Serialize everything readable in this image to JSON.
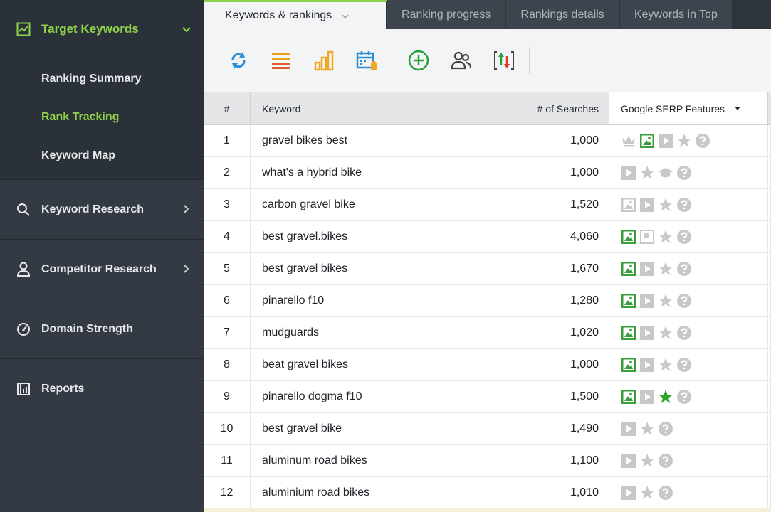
{
  "sidebar": {
    "main": {
      "label": "Target Keywords",
      "icon": "chart-line-icon"
    },
    "sub_items": [
      {
        "label": "Ranking Summary",
        "active": false
      },
      {
        "label": "Rank Tracking",
        "active": true
      },
      {
        "label": "Keyword Map",
        "active": false
      }
    ],
    "items": [
      {
        "label": "Keyword Research",
        "icon": "search-icon",
        "has_chevron": true
      },
      {
        "label": "Competitor Research",
        "icon": "user-icon",
        "has_chevron": true
      },
      {
        "label": "Domain Strength",
        "icon": "gauge-icon",
        "has_chevron": false
      },
      {
        "label": "Reports",
        "icon": "report-icon",
        "has_chevron": false
      }
    ]
  },
  "tabs": [
    {
      "label": "Keywords & rankings",
      "active": true
    },
    {
      "label": "Ranking progress",
      "active": false
    },
    {
      "label": "Rankings details",
      "active": false
    },
    {
      "label": "Keywords in Top",
      "active": false
    }
  ],
  "toolbar": {
    "buttons": [
      "refresh-icon",
      "list-icon",
      "bar-chart-icon",
      "calendar-alert-icon",
      "add-circle-icon",
      "users-icon",
      "sort-arrows-icon"
    ]
  },
  "table": {
    "headers": {
      "num": "#",
      "keyword": "Keyword",
      "searches": "# of Searches",
      "serp": "Google SERP Features"
    },
    "rows": [
      {
        "num": "1",
        "keyword": "gravel bikes best",
        "searches": "1,000",
        "serp": [
          "crown",
          "image-green",
          "video",
          "star",
          "question"
        ]
      },
      {
        "num": "2",
        "keyword": "what's a hybrid bike",
        "searches": "1,000",
        "serp": [
          "video",
          "star",
          "cap",
          "question"
        ]
      },
      {
        "num": "3",
        "keyword": "carbon gravel bike",
        "searches": "1,520",
        "serp": [
          "image-gray",
          "video",
          "star",
          "question"
        ]
      },
      {
        "num": "4",
        "keyword": "best gravel.bikes",
        "searches": "4,060",
        "serp": [
          "image-green",
          "snippet",
          "star",
          "question"
        ]
      },
      {
        "num": "5",
        "keyword": "best gravel bikes",
        "searches": "1,670",
        "serp": [
          "image-green",
          "video",
          "star",
          "question"
        ]
      },
      {
        "num": "6",
        "keyword": "pinarello f10",
        "searches": "1,280",
        "serp": [
          "image-green",
          "video",
          "star",
          "question"
        ]
      },
      {
        "num": "7",
        "keyword": "mudguards",
        "searches": "1,020",
        "serp": [
          "image-green",
          "video",
          "star",
          "question"
        ]
      },
      {
        "num": "8",
        "keyword": "beat gravel bikes",
        "searches": "1,000",
        "serp": [
          "image-green",
          "video",
          "star",
          "question"
        ]
      },
      {
        "num": "9",
        "keyword": "pinarello dogma f10",
        "searches": "1,500",
        "serp": [
          "image-green",
          "video",
          "star-green",
          "question"
        ]
      },
      {
        "num": "10",
        "keyword": "best gravel bike",
        "searches": "1,490",
        "serp": [
          "video",
          "star",
          "question"
        ]
      },
      {
        "num": "11",
        "keyword": "aluminum road bikes",
        "searches": "1,100",
        "serp": [
          "video",
          "star",
          "question"
        ]
      },
      {
        "num": "12",
        "keyword": "aluminium road bikes",
        "searches": "1,010",
        "serp": [
          "video",
          "star",
          "question"
        ]
      }
    ]
  },
  "colors": {
    "accent": "#8ed14a",
    "sidebar_bg": "#333a44",
    "serp_gray": "#c8c8c8",
    "serp_green": "#3c9c3c"
  }
}
